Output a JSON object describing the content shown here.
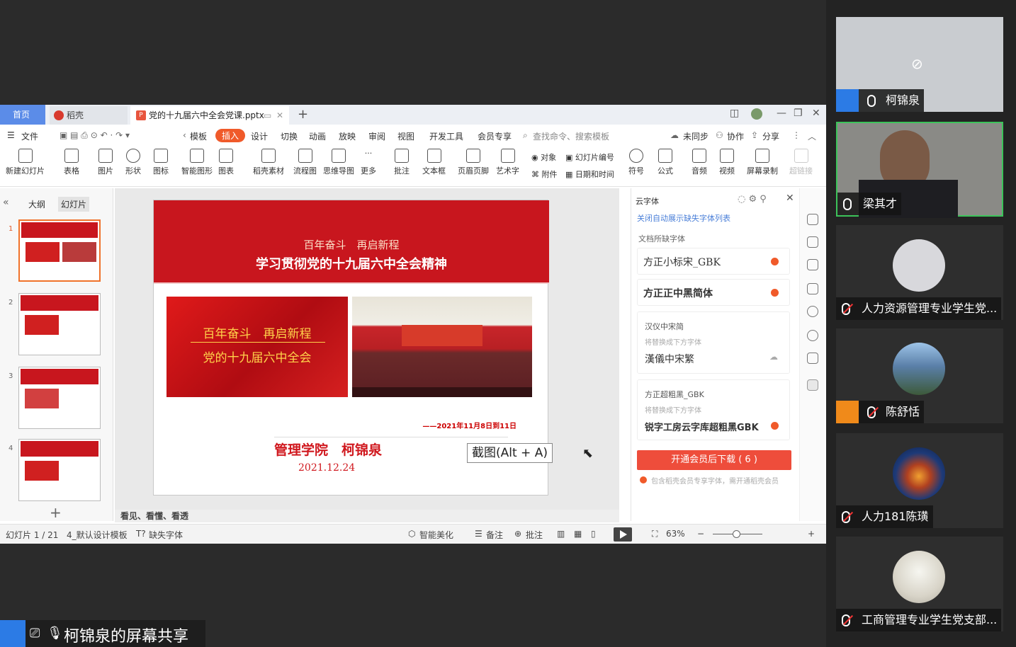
{
  "wps": {
    "tabs": {
      "home": "首页",
      "daoke": "稻壳",
      "file": "党的十九届六中全会党课.pptx"
    },
    "menu": [
      "文件",
      "模板",
      "插入",
      "设计",
      "切换",
      "动画",
      "放映",
      "审阅",
      "视图",
      "开发工具",
      "会员专享"
    ],
    "menu_active": "插入",
    "search_placeholder": "查找命令、搜索模板",
    "sync": "未同步",
    "collab": "协作",
    "share": "分享",
    "ribbon": [
      "新建幻灯片",
      "表格",
      "图片",
      "形状",
      "图标",
      "智能图形",
      "图表",
      "稻壳素材",
      "流程图",
      "思维导图",
      "更多",
      "批注",
      "文本框",
      "页眉页脚",
      "艺术字",
      "符号",
      "公式",
      "音频",
      "视频",
      "屏幕录制",
      "超链接"
    ],
    "ribbon_small": {
      "object": "对象",
      "slide_num": "幻灯片编号",
      "attach": "附件",
      "datetime": "日期和时间"
    },
    "left_tabs": {
      "outline": "大纲",
      "slides": "幻灯片"
    },
    "thumb_nums": [
      "1",
      "2",
      "3",
      "4"
    ],
    "slide": {
      "subtitle": "百年奋斗　再启新程",
      "title": "学习贯彻党的十九届六中全会精神",
      "box_line1": "百年奋斗　再启新程",
      "box_line2": "党的十九届六中全会",
      "date_range": "——2021年11月8日到11日",
      "author": "管理学院　柯锦泉",
      "date": "2021.12.24"
    },
    "tooltip": "截图(Alt + A)",
    "notes_text": "看见、看懂、看透",
    "font_panel": {
      "title": "云字体",
      "close_link": "关闭自动展示缺失字体列表",
      "section": "文档所缺字体",
      "font1": "方正小标宋_GBK",
      "font2": "方正正中黑简体",
      "font3_name": "汉仪中宋简",
      "font3_hint": "将替换成下方字体",
      "font3_sub": "漢儀中宋繁",
      "font4_name": "方正超粗黑_GBK",
      "font4_hint": "将替换成下方字体",
      "font4_sub": "锐字工房云字库超粗黑GBK",
      "download_btn": "开通会员后下载 ( 6 )",
      "footnote": "包含稻壳会员专享字体，需开通稻壳会员"
    },
    "status": {
      "slide_count": "幻灯片 1 / 21",
      "template": "4_默认设计模板",
      "missing_font": "缺失字体",
      "beautify": "智能美化",
      "notes": "备注",
      "comment": "批注",
      "zoom": "63%"
    }
  },
  "meeting": {
    "share_label": "柯锦泉的屏幕共享",
    "participants": [
      {
        "name": "柯锦泉",
        "mic": "on",
        "video": "off"
      },
      {
        "name": "梁其才",
        "mic": "on",
        "video": "on"
      },
      {
        "name": "人力资源管理专业学生党...",
        "mic": "off",
        "video": "off"
      },
      {
        "name": "陈舒恬",
        "mic": "off",
        "video": "off"
      },
      {
        "name": "人力181陈璜",
        "mic": "off",
        "video": "off"
      },
      {
        "name": "工商管理专业学生党支部...",
        "mic": "off",
        "video": "off"
      }
    ]
  },
  "colors": {
    "accent": "#f05a2a",
    "slide_red": "#c8161e",
    "meeting_blue": "#2c7be5"
  }
}
